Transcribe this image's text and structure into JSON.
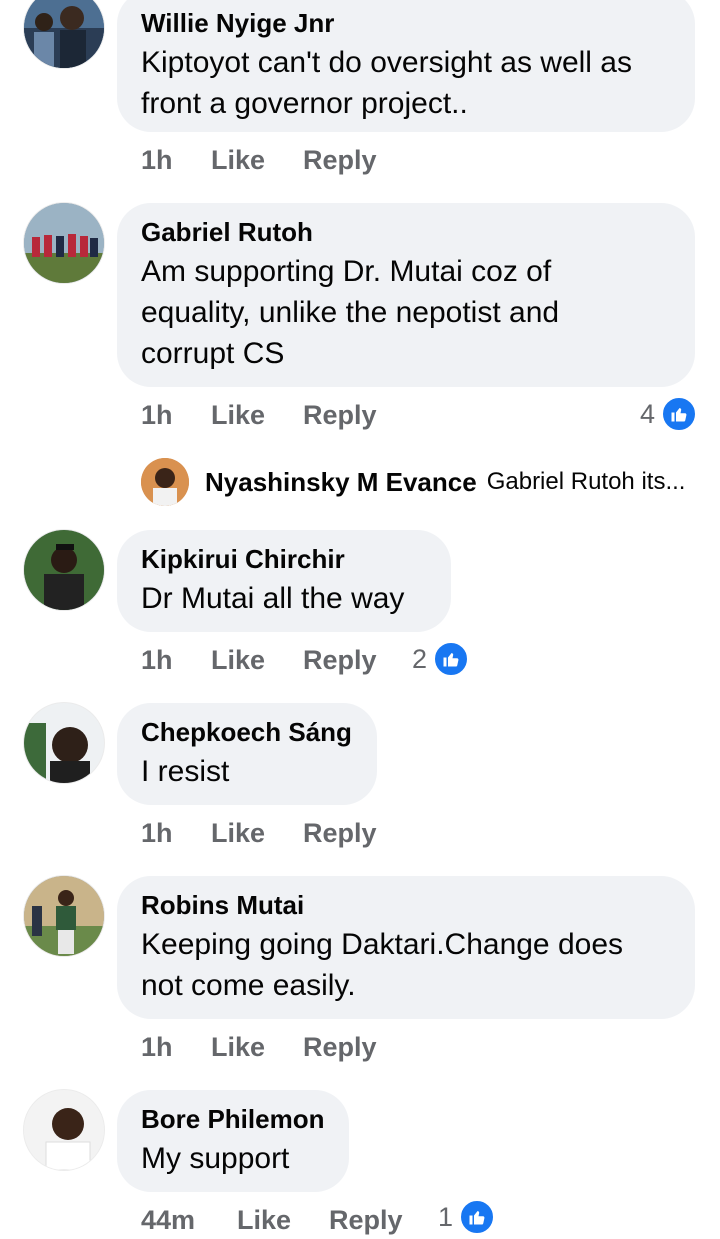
{
  "comments": [
    {
      "author": "Willie Nyige Jnr",
      "lines": [
        "Kiptoyot can't do oversight as well as",
        "front a governor project.."
      ],
      "time": "1h",
      "like": "Like",
      "reply": "Reply"
    },
    {
      "author": "Gabriel Rutoh",
      "lines": [
        "Am supporting Dr. Mutai coz of",
        "equality, unlike the nepotist and",
        "corrupt CS"
      ],
      "time": "1h",
      "like": "Like",
      "reply": "Reply",
      "reaction_count": "4",
      "reply_preview": {
        "author": "Nyashinsky M Evance",
        "snippet": "Gabriel Rutoh its..."
      }
    },
    {
      "author": "Kipkirui Chirchir",
      "lines": [
        "Dr Mutai all the way"
      ],
      "time": "1h",
      "like": "Like",
      "reply": "Reply",
      "reaction_count": "2"
    },
    {
      "author": "Chepkoech Sáng",
      "lines": [
        "I resist"
      ],
      "time": "1h",
      "like": "Like",
      "reply": "Reply"
    },
    {
      "author": "Robins Mutai",
      "lines": [
        "Keeping going Daktari.Change does",
        "not come easily."
      ],
      "time": "1h",
      "like": "Like",
      "reply": "Reply"
    },
    {
      "author": "Bore Philemon",
      "lines": [
        "My support"
      ],
      "time": "44m",
      "like": "Like",
      "reply": "Reply",
      "reaction_count": "1"
    }
  ],
  "icons": {
    "reaction": "thumbs-up-icon"
  },
  "colors": {
    "bubble": "#f0f2f5",
    "meta_text": "#65676b",
    "like_blue": "#1877f2"
  }
}
